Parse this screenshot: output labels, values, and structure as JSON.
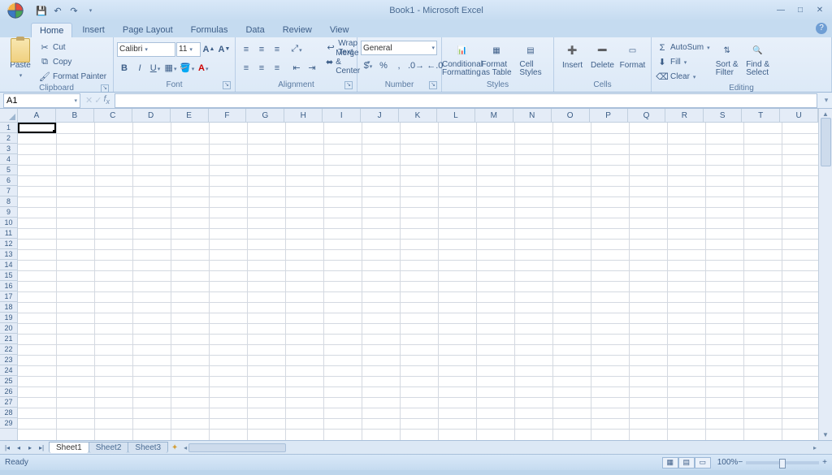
{
  "title": "Book1 - Microsoft Excel",
  "tabs": [
    "Home",
    "Insert",
    "Page Layout",
    "Formulas",
    "Data",
    "Review",
    "View"
  ],
  "active_tab": "Home",
  "clipboard": {
    "label": "Clipboard",
    "paste": "Paste",
    "cut": "Cut",
    "copy": "Copy",
    "fp": "Format Painter"
  },
  "font": {
    "label": "Font",
    "name": "Calibri",
    "size": "11"
  },
  "alignment": {
    "label": "Alignment",
    "wrap": "Wrap Text",
    "merge": "Merge & Center"
  },
  "number": {
    "label": "Number",
    "format": "General"
  },
  "styles": {
    "label": "Styles",
    "cf": "Conditional\nFormatting",
    "fat": "Format\nas Table",
    "cs": "Cell\nStyles"
  },
  "cells_grp": {
    "label": "Cells",
    "insert": "Insert",
    "delete": "Delete",
    "format": "Format"
  },
  "editing": {
    "label": "Editing",
    "autosum": "AutoSum",
    "fill": "Fill",
    "clear": "Clear",
    "sort": "Sort &\nFilter",
    "find": "Find &\nSelect"
  },
  "namebox": "A1",
  "columns": [
    "A",
    "B",
    "C",
    "D",
    "E",
    "F",
    "G",
    "H",
    "I",
    "J",
    "K",
    "L",
    "M",
    "N",
    "O",
    "P",
    "Q",
    "R",
    "S",
    "T",
    "U"
  ],
  "row_count": 29,
  "sheets": [
    "Sheet1",
    "Sheet2",
    "Sheet3"
  ],
  "active_sheet": "Sheet1",
  "status": "Ready",
  "zoom": "100%"
}
